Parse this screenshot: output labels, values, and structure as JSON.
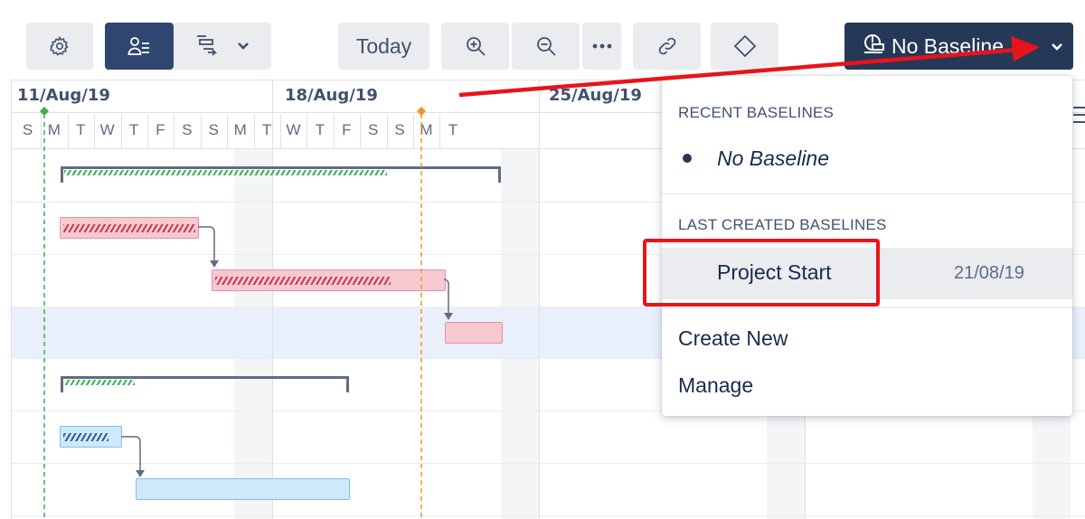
{
  "toolbar": {
    "today_label": "Today",
    "baseline_label": "No Baseline",
    "buttons": [
      "gear-icon",
      "people-list-icon",
      "arrange-icon",
      "chevron-down-icon",
      "zoom-in-icon",
      "zoom-out-icon",
      "more-icon",
      "link-icon",
      "milestone-diamond-icon"
    ]
  },
  "timeline": {
    "weeks": [
      "11/Aug/19",
      "18/Aug/19",
      "25/Aug/19"
    ],
    "days": [
      "S",
      "M",
      "T",
      "W",
      "T",
      "F",
      "S",
      "S",
      "M",
      "T",
      "W",
      "T",
      "F",
      "S",
      "S",
      "M",
      "T"
    ]
  },
  "baseline_menu": {
    "recent_header": "RECENT BASELINES",
    "recent_items": [
      {
        "label": "No Baseline",
        "selected": true
      }
    ],
    "last_created_header": "LAST CREATED BASELINES",
    "last_created_items": [
      {
        "label": "Project Start",
        "date": "21/08/19"
      }
    ],
    "actions": [
      "Create New",
      "Manage"
    ]
  },
  "colors": {
    "accent": "#253858",
    "annotation": "#e8141b",
    "today_marker": "#f0932b",
    "start_marker": "#36b24a"
  }
}
